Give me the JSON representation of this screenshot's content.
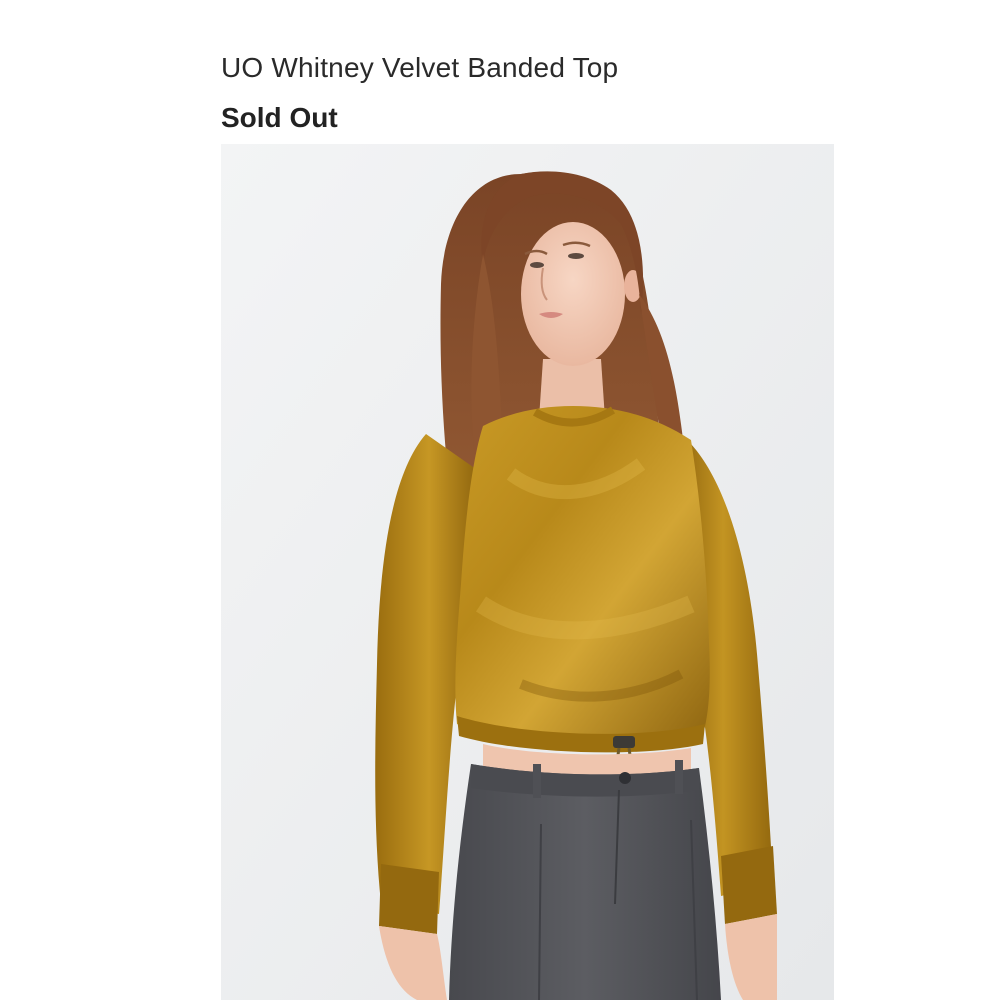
{
  "product": {
    "title": "UO Whitney Velvet Banded Top",
    "status": "Sold Out",
    "image": {
      "subject": "model wearing mustard velvet cropped banded top with grey pants",
      "colors": {
        "backdrop": "#eef0f1",
        "velvet": "#b8891a",
        "velvet_highlight": "#d9ae3a",
        "velvet_shadow": "#7a5408",
        "hair": "#8a4f2c",
        "skin": "#f2c9b4",
        "pants": "#55565b"
      }
    }
  }
}
